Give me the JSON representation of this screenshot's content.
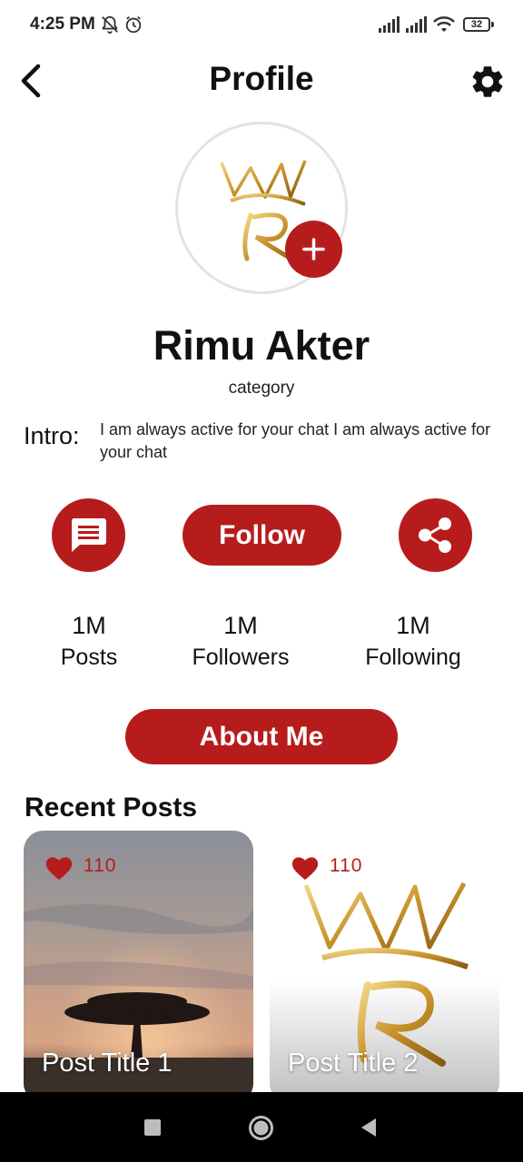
{
  "status_bar": {
    "time": "4:25 PM",
    "battery": "32",
    "icons": [
      "notifications-off-icon",
      "alarm-icon",
      "signal-icon",
      "signal-icon",
      "wifi-icon",
      "battery-icon"
    ]
  },
  "header": {
    "title": "Profile",
    "back_icon": "back-icon",
    "settings_icon": "gear-icon"
  },
  "profile": {
    "avatar_icon": "crown-r-logo",
    "add_icon": "plus-icon",
    "name": "Rimu Akter",
    "category": "category",
    "intro_label": "Intro:",
    "intro_text": "I am always active for your chat I am always active for your chat"
  },
  "actions": {
    "message_icon": "message-icon",
    "follow_label": "Follow",
    "share_icon": "share-icon"
  },
  "stats": [
    {
      "value": "1M",
      "label": "Posts"
    },
    {
      "value": "1M",
      "label": "Followers"
    },
    {
      "value": "1M",
      "label": "Following"
    }
  ],
  "about_label": "About Me",
  "recent_posts": {
    "title": "Recent Posts",
    "items": [
      {
        "title": "Post Title 1",
        "likes": "110"
      },
      {
        "title": "Post Title 2",
        "likes": "110"
      }
    ]
  },
  "nav": {
    "icons": [
      "recents-icon",
      "home-icon",
      "back-triangle-icon"
    ]
  },
  "colors": {
    "accent": "#b71c1c",
    "background": "#ffffff",
    "text": "#111111",
    "gold": "#d4a53a"
  }
}
